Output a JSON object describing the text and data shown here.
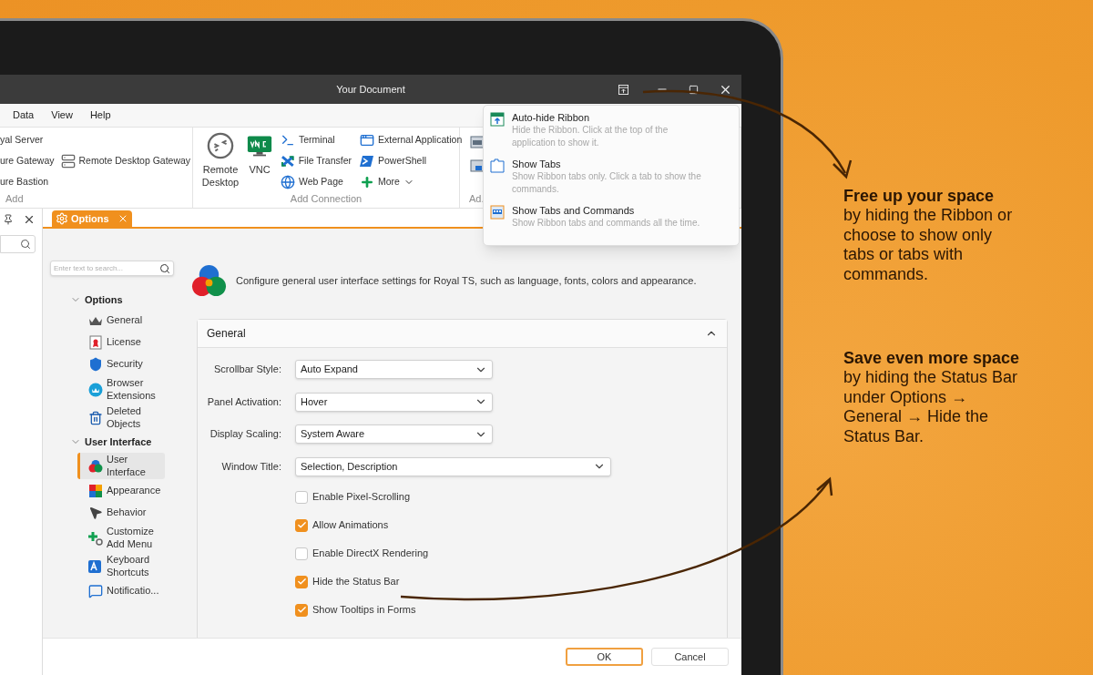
{
  "window": {
    "title": "Your Document"
  },
  "menu": [
    "Data",
    "View",
    "Help"
  ],
  "ribbon": {
    "groups": [
      {
        "label": "Add",
        "columns": [
          [
            "yal Server",
            "ure Gateway",
            "ure Bastion"
          ],
          [
            "Remote Desktop Gateway"
          ]
        ]
      },
      {
        "label": "Add Connection",
        "big_buttons": [
          "Remote Desktop",
          "VNC"
        ],
        "columns": [
          [
            "Terminal",
            "File Transfer",
            "Web Page"
          ],
          [
            "External Application",
            "PowerShell",
            {
              "label": "More",
              "dropdown": true
            }
          ]
        ]
      },
      {
        "label": "Ad."
      }
    ]
  },
  "ribbon_menu": [
    {
      "title": "Auto-hide Ribbon",
      "description": "Hide the Ribbon. Click at the top of the application to show it."
    },
    {
      "title": "Show Tabs",
      "description": "Show Ribbon tabs only. Click a tab to show the commands."
    },
    {
      "title": "Show Tabs and Commands",
      "description": "Show Ribbon tabs and commands all the time."
    }
  ],
  "tabs": [
    {
      "label": "Options",
      "selected": true
    }
  ],
  "nav": {
    "search_placeholder": "Enter text to search...",
    "tree": [
      {
        "label": "Options",
        "expanded": true,
        "children": [
          {
            "label": "General",
            "selected": false
          },
          {
            "label": "License",
            "selected": false
          },
          {
            "label": "Security",
            "selected": false
          },
          {
            "label": "Browser Extensions",
            "selected": false
          },
          {
            "label": "Deleted Objects",
            "selected": false
          }
        ]
      },
      {
        "label": "User Interface",
        "expanded": true,
        "children": [
          {
            "label": "User Interface",
            "selected": true
          },
          {
            "label": "Appearance",
            "selected": false
          },
          {
            "label": "Behavior",
            "selected": false
          },
          {
            "label": "Customize Add Menu",
            "selected": false
          },
          {
            "label": "Keyboard Shortcuts",
            "selected": false
          },
          {
            "label": "Notificatio...",
            "selected": false
          }
        ]
      }
    ]
  },
  "description": "Configure general user interface settings for Royal TS, such as language, fonts, colors and appearance.",
  "section": {
    "title": "General",
    "expanded": true,
    "fields": [
      {
        "kind": "select",
        "label": "Scrollbar Style:",
        "value": "Auto Expand"
      },
      {
        "kind": "select",
        "label": "Panel Activation:",
        "value": "Hover"
      },
      {
        "kind": "select",
        "label": "Display Scaling:",
        "value": "System Aware"
      },
      {
        "kind": "wideselect",
        "label": "Window Title:",
        "value": "Selection, Description"
      },
      {
        "kind": "checkbox",
        "label": "Enable Pixel-Scrolling",
        "checked": false
      },
      {
        "kind": "checkbox",
        "label": "Allow Animations",
        "checked": true
      },
      {
        "kind": "checkbox",
        "label": "Enable DirectX Rendering",
        "checked": false
      },
      {
        "kind": "checkbox",
        "label": "Hide the Status Bar",
        "checked": true
      },
      {
        "kind": "checkbox",
        "label": "Show Tooltips in Forms",
        "checked": true
      }
    ]
  },
  "buttons": [
    {
      "label": "OK",
      "default": true
    },
    {
      "label": "Cancel",
      "default": false
    }
  ],
  "callouts": [
    {
      "heading": "Free up your space",
      "body": "by hiding the Ribbon or choose to show only tabs or tabs with commands."
    },
    {
      "heading": "Save even more space",
      "body": "by hiding the Status Bar under Options → General → Hide the Status Bar."
    }
  ]
}
